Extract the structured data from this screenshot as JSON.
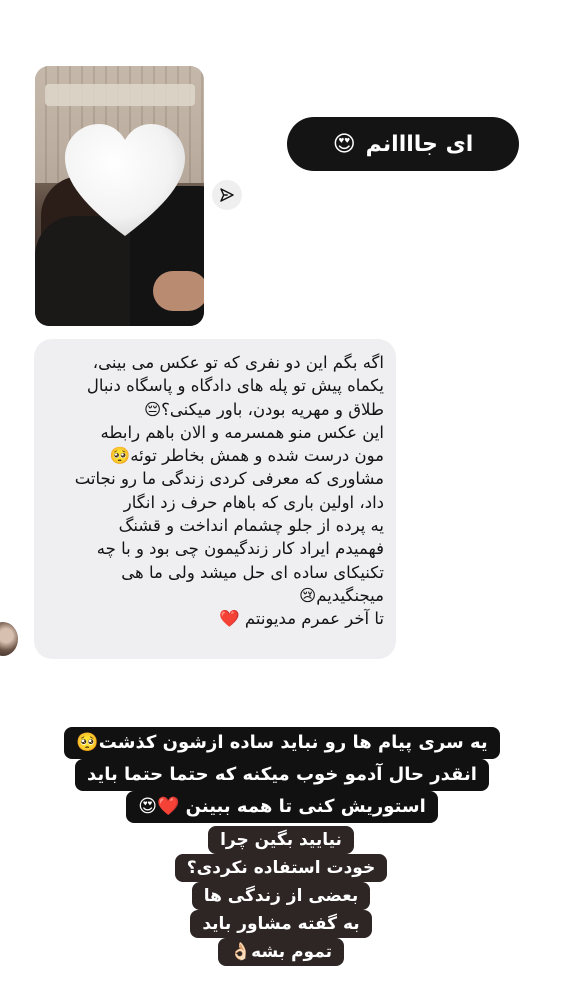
{
  "story": {
    "reply_pill": {
      "text": "ای جاااانم",
      "emoji": "😍"
    },
    "photo": {
      "overlay_icon": "white-heart-sticker"
    },
    "share_icon": "paper-plane-icon",
    "message": {
      "text": "اگه بگم این دو نفری که تو عکس می بینی،\nیکماه پیش تو پله های دادگاه و پاسگاه دنبال\nطلاق و مهریه بودن، باور میکنی؟😔\nاین عکس منو همسرمه و الان باهم رابطه\nمون درست شده و همش بخاطر توئه🥺\nمشاوری  که معرفی کردی زندگی ما رو نجاتت\nداد، اولین باری که باهام حرف زد انگار\nیه پرده از جلو چشمام انداخت و قشنگ\nفهمیدم ایراد کار زندگیمون چی بود و با چه\nتکنیکای ساده ای حل میشد ولی ما هی\nمیجنگیدیم😢\nتا آخر عمرم مدیونتم ❤️"
    },
    "caption_top": [
      "یه سری پیام ها رو نباید ساده ازشون کذشت🥺",
      "انقدر حال آدمو خوب میکنه که حتما حتما باید",
      "استوریش کنی تا همه ببینن ❤️😍"
    ],
    "caption_bottom": [
      "نیایید بگین چرا",
      "خودت استفاده نکردی؟",
      "بعضی از زندگی ها",
      "به گفته مشاور باید",
      "تموم بشه👌🏻"
    ]
  }
}
